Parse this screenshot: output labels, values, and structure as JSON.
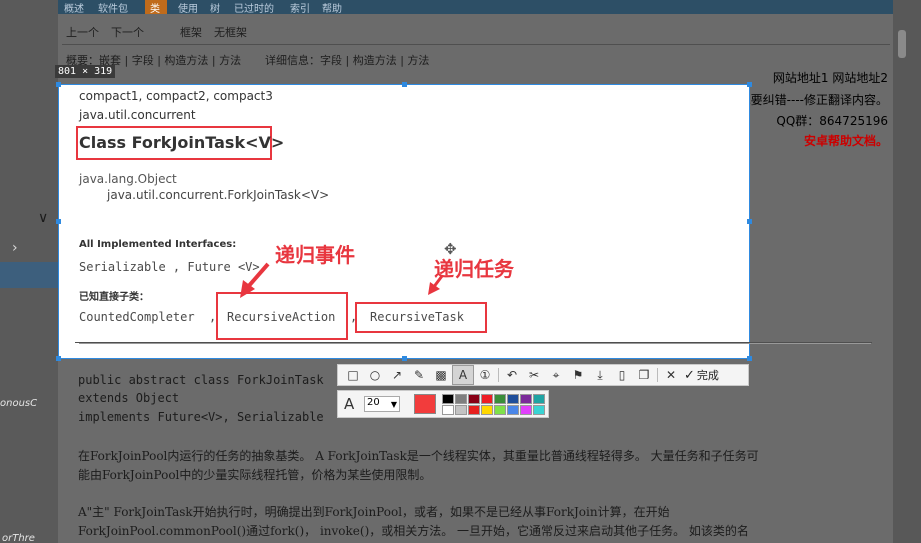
{
  "topnav": {
    "items": [
      "概述",
      "软件包",
      "类",
      "使用",
      "树",
      "已过时的",
      "索引",
      "帮助"
    ]
  },
  "nav2": {
    "prev": "上一个",
    "next": "下一个",
    "frames": "框架",
    "noframes": "无框架"
  },
  "nav3": {
    "summary": "概要：嵌套 | 字段 | 构造方法 | 方法",
    "detail": "详细信息：字段 | 构造方法 | 方法"
  },
  "size_badge": "801 × 319",
  "right_info": {
    "links": "网站地址1 网站地址2",
    "fix": "我要纠错----修正翻译内容。",
    "qq": "QQ群：864725196",
    "android": "安卓帮助文档。"
  },
  "doc": {
    "compact": "compact1, compact2, compact3",
    "package": "java.util.concurrent",
    "class_title": "Class ForkJoinTask<V>",
    "hier_root": "java.lang.Object",
    "hier_self": "java.util.concurrent.ForkJoinTask<V>",
    "interfaces_label": "All Implemented Interfaces:",
    "interfaces_value": "Serializable ,  Future <V>",
    "subclasses_label": "已知直接子类：",
    "sub1": "CountedCompleter",
    "sub1_sep": ",",
    "sub2": "RecursiveAction",
    "sub2_sep": ",",
    "sub3": "RecursiveTask"
  },
  "annotations": {
    "event": "递归事件",
    "task": "递归任务"
  },
  "code": {
    "line1": "public abstract class ForkJoinTask",
    "line2": "extends Object",
    "line3": "implements Future<V>, Serializable",
    "para1a": "在ForkJoinPool内运行的任务的抽象基类。 A ForkJoinTask是一个线程实体，其重量比普通线程轻得多。 大量任务和子任务可",
    "para1b": "能由ForkJoinPool中的少量实际线程托管，价格为某些使用限制。",
    "para2a": "A\"主\" ForkJoinTask开始执行时，明确提出到ForkJoinPool，或者，如果不是已经从事ForkJoin计算，在开始",
    "para2b": "ForkJoinPool.commonPool()通过fork()， invoke()，或相关方法。 一旦开始，它通常反过来启动其他子任务。 如该类的名"
  },
  "left": {
    "text1": "onousC",
    "text2": "orThre"
  },
  "toolbar": {
    "done_label": "完成",
    "icons": [
      "rect-icon",
      "ellipse-icon",
      "arrow-icon",
      "pen-icon",
      "mosaic-icon",
      "text-icon",
      "number-icon",
      "undo-icon",
      "crop-icon",
      "ocr-icon",
      "pin-icon",
      "download-icon",
      "save-icon",
      "bookmark-icon",
      "cancel-icon",
      "done-icon"
    ]
  },
  "colorbar": {
    "font_size": "20",
    "current_color": "#f23c3c",
    "palette": [
      "#000000",
      "#7f7f7f",
      "#880015",
      "#ed1c24",
      "#3a8e3a",
      "#1f4e9a",
      "#7b2b9a",
      "#1fa3a3",
      "#ffffff",
      "#c3c3c3",
      "#e6201e",
      "#ffd700",
      "#7fe04a",
      "#4a86e8",
      "#e040fb",
      "#3ad3d3"
    ]
  }
}
